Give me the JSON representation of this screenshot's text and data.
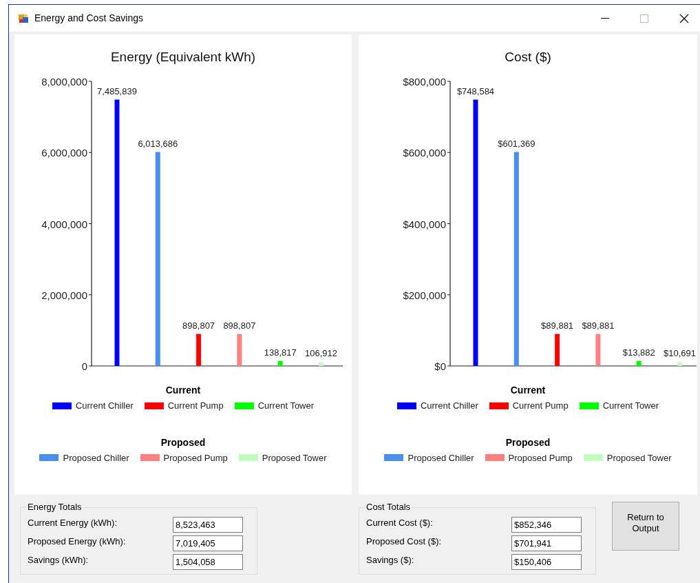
{
  "window": {
    "title": "Energy and Cost Savings"
  },
  "charts": [
    {
      "legend": [
        {
          "title": "Current"
        },
        {
          "title": "Proposed"
        }
      ],
      "chart_data": {
        "type": "bar",
        "title": "Energy (Equivalent kWh)",
        "ylim": [
          0,
          8000000
        ],
        "yticks": [
          {
            "value": 0,
            "label": "0"
          },
          {
            "value": 2000000,
            "label": "2,000,000"
          },
          {
            "value": 4000000,
            "label": "4,000,000"
          },
          {
            "value": 6000000,
            "label": "6,000,000"
          },
          {
            "value": 8000000,
            "label": "8,000,000"
          }
        ],
        "series": [
          {
            "name": "Current Chiller",
            "color": "#0000ff",
            "values": [
              7485839
            ],
            "value_labels": [
              "7,485,839"
            ]
          },
          {
            "name": "Proposed Chiller",
            "color": "#4a8ef0",
            "values": [
              6013686
            ],
            "value_labels": [
              "6,013,686"
            ]
          },
          {
            "name": "Current Pump",
            "color": "#ff0000",
            "values": [
              898807
            ],
            "value_labels": [
              "898,807"
            ]
          },
          {
            "name": "Proposed Pump",
            "color": "#ff8080",
            "values": [
              898807
            ],
            "value_labels": [
              "898,807"
            ]
          },
          {
            "name": "Current Tower",
            "color": "#00ff00",
            "values": [
              138817
            ],
            "value_labels": [
              "138,817"
            ]
          },
          {
            "name": "Proposed Tower",
            "color": "#c0ffc0",
            "values": [
              106912
            ],
            "value_labels": [
              "106,912"
            ]
          }
        ]
      }
    },
    {
      "legend": [
        {
          "title": "Current"
        },
        {
          "title": "Proposed"
        }
      ],
      "chart_data": {
        "type": "bar",
        "title": "Cost ($)",
        "ylim": [
          0,
          800000
        ],
        "yticks": [
          {
            "value": 0,
            "label": "$0"
          },
          {
            "value": 200000,
            "label": "$200,000"
          },
          {
            "value": 400000,
            "label": "$400,000"
          },
          {
            "value": 600000,
            "label": "$600,000"
          },
          {
            "value": 800000,
            "label": "$800,000"
          }
        ],
        "series": [
          {
            "name": "Current Chiller",
            "color": "#0000ff",
            "values": [
              748584
            ],
            "value_labels": [
              "$748,584"
            ]
          },
          {
            "name": "Proposed Chiller",
            "color": "#4a8ef0",
            "values": [
              601369
            ],
            "value_labels": [
              "$601,369"
            ]
          },
          {
            "name": "Current Pump",
            "color": "#ff0000",
            "values": [
              89881
            ],
            "value_labels": [
              "$89,881"
            ]
          },
          {
            "name": "Proposed Pump",
            "color": "#ff8080",
            "values": [
              89881
            ],
            "value_labels": [
              "$89,881"
            ]
          },
          {
            "name": "Current Tower",
            "color": "#00ff00",
            "values": [
              13882
            ],
            "value_labels": [
              "$13,882"
            ]
          },
          {
            "name": "Proposed Tower",
            "color": "#c0ffc0",
            "values": [
              10691
            ],
            "value_labels": [
              "$10,691"
            ]
          }
        ]
      }
    }
  ],
  "totals": [
    {
      "title": "Energy Totals",
      "rows": [
        {
          "label": "Current Energy (kWh):",
          "value": "8,523,463"
        },
        {
          "label": "Proposed Energy (kWh):",
          "value": "7,019,405"
        },
        {
          "label": "Savings (kWh):",
          "value": "1,504,058"
        }
      ]
    },
    {
      "title": "Cost Totals",
      "rows": [
        {
          "label": "Current Cost ($):",
          "value": "$852,346"
        },
        {
          "label": "Proposed Cost ($):",
          "value": "$701,941"
        },
        {
          "label": "Savings ($):",
          "value": "$150,406"
        }
      ]
    }
  ],
  "button": "Return to\nOutput"
}
